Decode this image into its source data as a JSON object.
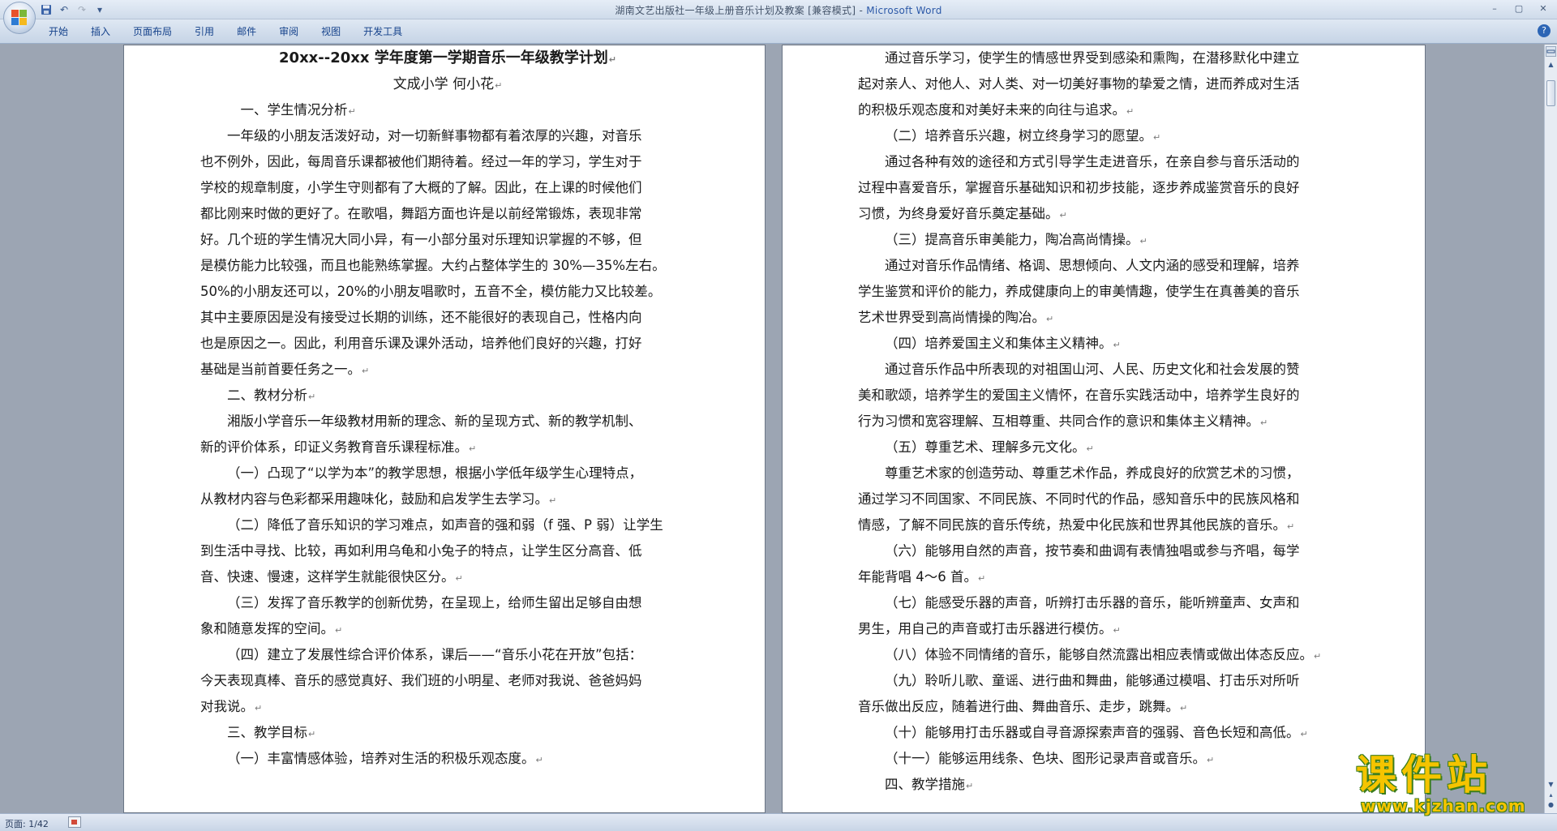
{
  "window": {
    "title": "湖南文艺出版社一年级上册音乐计划及教案 [兼容模式] - ",
    "app_name": "Microsoft Word",
    "minimize": "–",
    "maximize": "▢",
    "close": "✕"
  },
  "quick_access": {
    "save_icon": "floppy-save-icon",
    "undo_glyph": "↶",
    "redo_glyph": "↷",
    "customize_glyph": "▾"
  },
  "ribbon": {
    "tabs": [
      "开始",
      "插入",
      "页面布局",
      "引用",
      "邮件",
      "审阅",
      "视图",
      "开发工具"
    ],
    "help_glyph": "?"
  },
  "document": {
    "left_page": [
      {
        "type": "title",
        "text": "20xx--20xx 学年度第一学期音乐一年级教学计划"
      },
      {
        "type": "sub",
        "text": "文成小学    何小花"
      },
      {
        "type": "h",
        "indent": 3,
        "text": "一、学生情况分析"
      },
      {
        "type": "p",
        "indent": 2,
        "text": "一年级的小朋友活泼好动，对一切新鲜事物都有着浓厚的兴趣，对音乐"
      },
      {
        "type": "c",
        "indent": 0,
        "text": "也不例外，因此，每周音乐课都被他们期待着。经过一年的学习，学生对于"
      },
      {
        "type": "c",
        "indent": 0,
        "text": "学校的规章制度，小学生守则都有了大概的了解。因此，在上课的时候他们"
      },
      {
        "type": "c",
        "indent": 0,
        "text": "都比刚来时做的更好了。在歌唱，舞蹈方面也许是以前经常锻炼，表现非常"
      },
      {
        "type": "c",
        "indent": 0,
        "text": "好。几个班的学生情况大同小异，有一小部分虽对乐理知识掌握的不够，但"
      },
      {
        "type": "c",
        "indent": 0,
        "text": "是模仿能力比较强，而且也能熟练掌握。大约占整体学生的 30%—35%左右。"
      },
      {
        "type": "c",
        "indent": 0,
        "text": "50%的小朋友还可以，20%的小朋友唱歌时，五音不全，模仿能力又比较差。"
      },
      {
        "type": "c",
        "indent": 0,
        "text": "其中主要原因是没有接受过长期的训练，还不能很好的表现自己，性格内向"
      },
      {
        "type": "c",
        "indent": 0,
        "text": "也是原因之一。因此，利用音乐课及课外活动，培养他们良好的兴趣，打好"
      },
      {
        "type": "e",
        "indent": 0,
        "text": "基础是当前首要任务之一。"
      },
      {
        "type": "h",
        "indent": 2,
        "text": "二、教材分析"
      },
      {
        "type": "p",
        "indent": 2,
        "text": "湘版小学音乐一年级教材用新的理念、新的呈现方式、新的教学机制、"
      },
      {
        "type": "e",
        "indent": 0,
        "text": "新的评价体系，印证义务教育音乐课程标准。"
      },
      {
        "type": "p",
        "indent": 2,
        "text": "（一）凸现了“以学为本”的教学思想，根据小学低年级学生心理特点，"
      },
      {
        "type": "e",
        "indent": 0,
        "text": "从教材内容与色彩都采用趣味化，鼓励和启发学生去学习。"
      },
      {
        "type": "p",
        "indent": 2,
        "text": "（二）降低了音乐知识的学习难点，如声音的强和弱（f 强、P 弱）让学生"
      },
      {
        "type": "c",
        "indent": 0,
        "text": "到生活中寻找、比较，再如利用乌龟和小兔子的特点，让学生区分高音、低"
      },
      {
        "type": "e",
        "indent": 0,
        "text": "音、快速、慢速，这样学生就能很快区分。"
      },
      {
        "type": "p",
        "indent": 2,
        "text": "（三）发挥了音乐教学的创新优势，在呈现上，给师生留出足够自由想"
      },
      {
        "type": "e",
        "indent": 0,
        "text": "象和随意发挥的空间。"
      },
      {
        "type": "p",
        "indent": 2,
        "text": "（四）建立了发展性综合评价体系，课后——“音乐小花在开放”包括："
      },
      {
        "type": "c",
        "indent": 0,
        "text": "今天表现真棒、音乐的感觉真好、我们班的小明星、老师对我说、爸爸妈妈"
      },
      {
        "type": "e",
        "indent": 0,
        "text": "对我说。"
      },
      {
        "type": "h",
        "indent": 2,
        "text": "三、教学目标"
      },
      {
        "type": "e",
        "indent": 2,
        "text": "（一）丰富情感体验，培养对生活的积极乐观态度。"
      }
    ],
    "right_page": [
      {
        "type": "p",
        "indent": 2,
        "text": "通过音乐学习，使学生的情感世界受到感染和熏陶，在潜移默化中建立"
      },
      {
        "type": "c",
        "indent": 0,
        "text": "起对亲人、对他人、对人类、对一切美好事物的挚爱之情，进而养成对生活"
      },
      {
        "type": "e",
        "indent": 0,
        "text": "的积极乐观态度和对美好未来的向往与追求。"
      },
      {
        "type": "e",
        "indent": 2,
        "text": "（二）培养音乐兴趣，树立终身学习的愿望。"
      },
      {
        "type": "p",
        "indent": 2,
        "text": "通过各种有效的途径和方式引导学生走进音乐，在亲自参与音乐活动的"
      },
      {
        "type": "c",
        "indent": 0,
        "text": "过程中喜爱音乐，掌握音乐基础知识和初步技能，逐步养成鉴赏音乐的良好"
      },
      {
        "type": "e",
        "indent": 0,
        "text": "习惯，为终身爱好音乐奠定基础。"
      },
      {
        "type": "e",
        "indent": 2,
        "text": "（三）提高音乐审美能力，陶冶高尚情操。"
      },
      {
        "type": "p",
        "indent": 2,
        "text": "通过对音乐作品情绪、格调、思想倾向、人文内涵的感受和理解，培养"
      },
      {
        "type": "c",
        "indent": 0,
        "text": "学生鉴赏和评价的能力，养成健康向上的审美情趣，使学生在真善美的音乐"
      },
      {
        "type": "e",
        "indent": 0,
        "text": "艺术世界受到高尚情操的陶冶。"
      },
      {
        "type": "e",
        "indent": 2,
        "text": "（四）培养爱国主义和集体主义精神。"
      },
      {
        "type": "p",
        "indent": 2,
        "text": "通过音乐作品中所表现的对祖国山河、人民、历史文化和社会发展的赞"
      },
      {
        "type": "c",
        "indent": 0,
        "text": "美和歌颂，培养学生的爱国主义情怀，在音乐实践活动中，培养学生良好的"
      },
      {
        "type": "e",
        "indent": 0,
        "text": "行为习惯和宽容理解、互相尊重、共同合作的意识和集体主义精神。"
      },
      {
        "type": "e",
        "indent": 2,
        "text": "（五）尊重艺术、理解多元文化。"
      },
      {
        "type": "p",
        "indent": 2,
        "text": "尊重艺术家的创造劳动、尊重艺术作品，养成良好的欣赏艺术的习惯，"
      },
      {
        "type": "c",
        "indent": 0,
        "text": "通过学习不同国家、不同民族、不同时代的作品，感知音乐中的民族风格和"
      },
      {
        "type": "e",
        "indent": 0,
        "text": "情感，了解不同民族的音乐传统，热爱中化民族和世界其他民族的音乐。"
      },
      {
        "type": "p",
        "indent": 2,
        "text": "（六）能够用自然的声音，按节奏和曲调有表情独唱或参与齐唱，每学"
      },
      {
        "type": "e",
        "indent": 0,
        "text": "年能背唱 4～6 首。"
      },
      {
        "type": "p",
        "indent": 2,
        "text": "（七）能感受乐器的声音，听辨打击乐器的音乐，能听辨童声、女声和"
      },
      {
        "type": "e",
        "indent": 0,
        "text": "男生，用自己的声音或打击乐器进行模仿。"
      },
      {
        "type": "e",
        "indent": 2,
        "text": "（八）体验不同情绪的音乐，能够自然流露出相应表情或做出体态反应。"
      },
      {
        "type": "p",
        "indent": 2,
        "text": "（九）聆听儿歌、童谣、进行曲和舞曲，能够通过模唱、打击乐对所听"
      },
      {
        "type": "e",
        "indent": 0,
        "text": "音乐做出反应，随着进行曲、舞曲音乐、走步，跳舞。"
      },
      {
        "type": "e",
        "indent": 2,
        "text": "（十）能够用打击乐器或自寻音源探索声音的强弱、音色长短和高低。"
      },
      {
        "type": "e",
        "indent": 2,
        "text": "（十一）能够运用线条、色块、图形记录声音或音乐。"
      },
      {
        "type": "h",
        "indent": 2,
        "text": "四、教学措施"
      }
    ],
    "paragraph_mark": "↵"
  },
  "status": {
    "page_info": "页面: 1/42"
  },
  "watermark": {
    "main": "课件站",
    "url": "www.kjzhan.com"
  },
  "colors": {
    "app_title": "#2c59a8",
    "ribbon_text": "#15428b",
    "watermark_fill": "#f5c400",
    "watermark_outline": "#3b7d1d"
  }
}
